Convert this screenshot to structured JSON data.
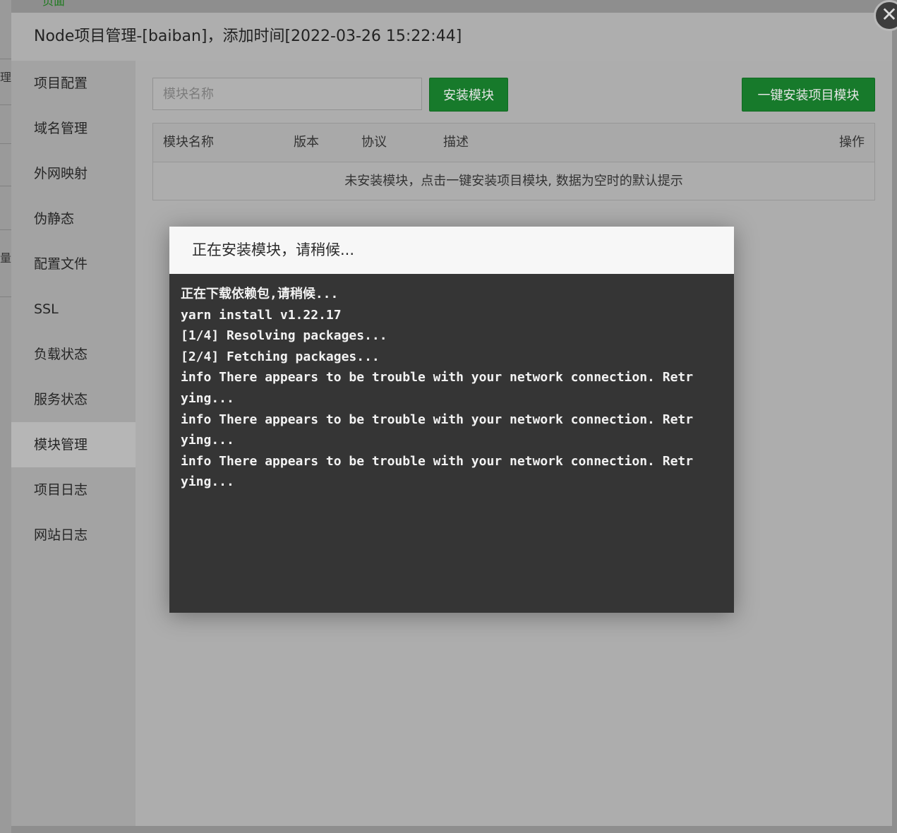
{
  "background": {
    "fragments": [
      "理",
      "量"
    ],
    "top_fragment": "页面"
  },
  "outer_modal": {
    "title": "Node项目管理-[baiban]，添加时间[2022-03-26 15:22:44]",
    "close_icon": "close-icon"
  },
  "sidebar": {
    "items": [
      {
        "label": "项目配置"
      },
      {
        "label": "域名管理"
      },
      {
        "label": "外网映射"
      },
      {
        "label": "伪静态"
      },
      {
        "label": "配置文件"
      },
      {
        "label": "SSL"
      },
      {
        "label": "负载状态"
      },
      {
        "label": "服务状态"
      },
      {
        "label": "模块管理",
        "active": true
      },
      {
        "label": "项目日志"
      },
      {
        "label": "网站日志"
      }
    ]
  },
  "toolbar": {
    "search_placeholder": "模块名称",
    "install_label": "安装模块",
    "onekey_label": "一键安装项目模块"
  },
  "table": {
    "columns": [
      "模块名称",
      "版本",
      "协议",
      "描述",
      "操作"
    ],
    "empty_text": "未安装模块，点击一键安装项目模块, 数据为空时的默认提示"
  },
  "dialog": {
    "title": "正在安装模块，请稍候...",
    "lines": [
      "正在下载依赖包,请稍候...",
      "yarn install v1.22.17",
      "[1/4] Resolving packages...",
      "[2/4] Fetching packages...",
      "info There appears to be trouble with your network connection. Retr",
      "ying...",
      "info There appears to be trouble with your network connection. Retr",
      "ying...",
      "info There appears to be trouble with your network connection. Retr",
      "ying..."
    ]
  }
}
